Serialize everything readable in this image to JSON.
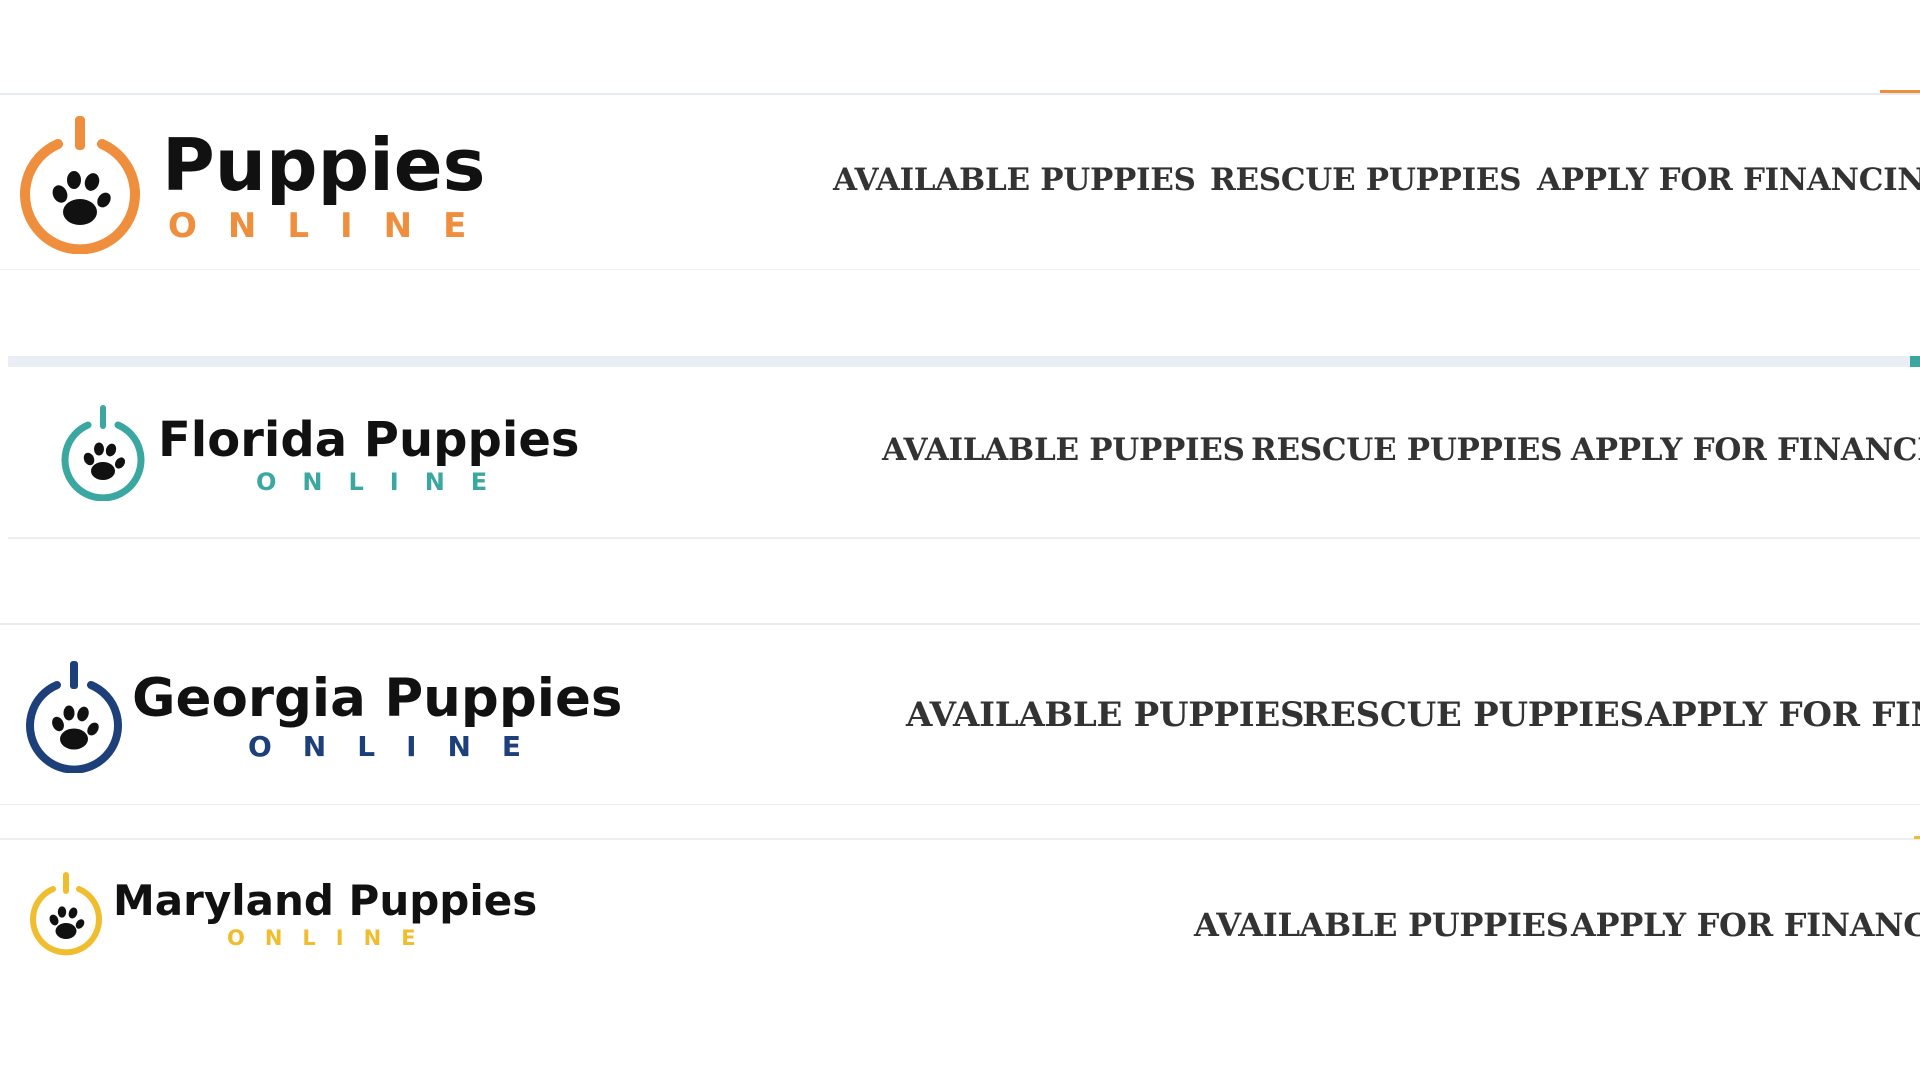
{
  "headers": [
    {
      "brand_name": "Puppies",
      "brand_sub": "ONLINE",
      "accent_color": "#ef8e3d",
      "logo_icon": "paw-power-icon",
      "nav": [
        "AVAILABLE PUPPIES",
        "RESCUE PUPPIES",
        "APPLY FOR FINANCING"
      ]
    },
    {
      "brand_name": "Florida Puppies",
      "brand_sub": "ONLINE",
      "accent_color": "#3aa7a1",
      "logo_icon": "paw-power-icon",
      "nav": [
        "AVAILABLE PUPPIES",
        "RESCUE PUPPIES",
        "APPLY FOR FINANCING"
      ]
    },
    {
      "brand_name": "Georgia Puppies",
      "brand_sub": "ONLINE",
      "accent_color": "#1d3f7a",
      "logo_icon": "paw-power-icon",
      "nav": [
        "AVAILABLE PUPPIES",
        "RESCUE PUPPIES",
        "APPLY FOR FINAN"
      ]
    },
    {
      "brand_name": "Maryland Puppies",
      "brand_sub": "ONLINE",
      "accent_color": "#f0bd2e",
      "logo_icon": "paw-power-icon",
      "nav": [
        "AVAILABLE PUPPIES",
        "APPLY FOR FINANCING"
      ]
    }
  ]
}
